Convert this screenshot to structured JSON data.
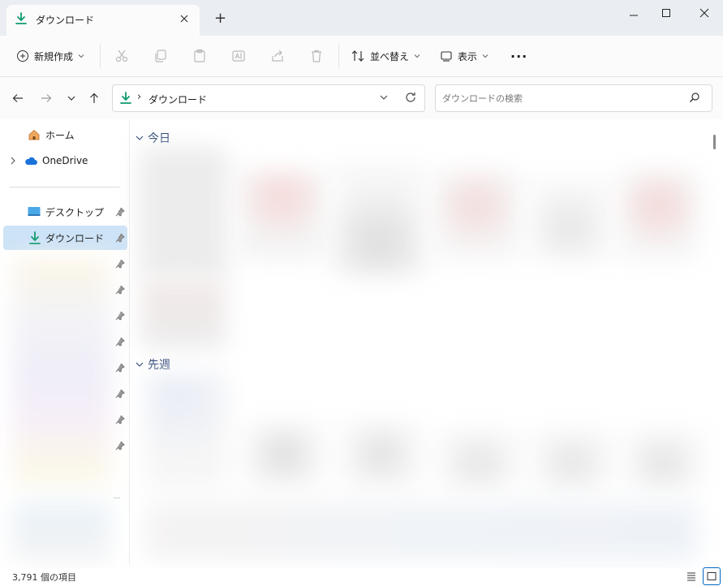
{
  "window": {
    "tab_title": "ダウンロード",
    "new_tab": "+"
  },
  "toolbar": {
    "new_label": "新規作成",
    "sort_label": "並べ替え",
    "view_label": "表示",
    "more_label": "···"
  },
  "address": {
    "breadcrumb_sep": "›",
    "location": "ダウンロード"
  },
  "search": {
    "placeholder": "ダウンロードの検索"
  },
  "sidebar": {
    "home": "ホーム",
    "onedrive": "OneDrive",
    "desktop": "デスクトップ",
    "downloads": "ダウンロード"
  },
  "content": {
    "group_today": "今日",
    "group_last_week": "先週"
  },
  "status": {
    "item_count": "3,791 個の項目"
  },
  "colors": {
    "accent": "#0e7a5b",
    "selection": "#cde3f7",
    "titlebar": "#eaeef3"
  }
}
